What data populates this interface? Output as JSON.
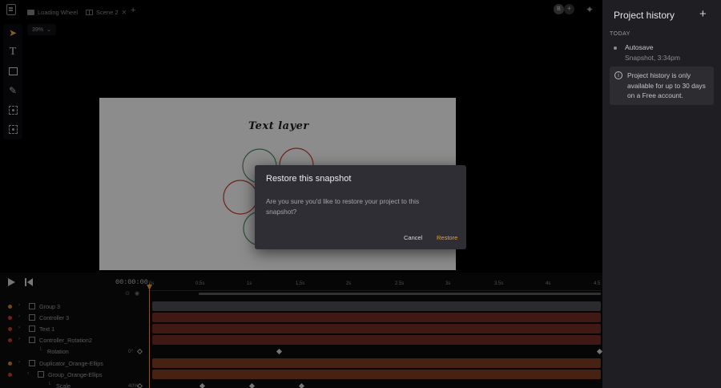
{
  "tabs": [
    {
      "label": "Loading Wheel",
      "icon": "folder-icon"
    },
    {
      "label": "Scene 2",
      "icon": "scene-icon"
    }
  ],
  "avatar_initial": "B",
  "zoom": "39%",
  "canvas": {
    "text_layer": "Text layer"
  },
  "dialog": {
    "title": "Restore this snapshot",
    "body": "Are you sure you'd like to restore your project to this snapshot?",
    "cancel": "Cancel",
    "restore": "Restore"
  },
  "timeline": {
    "timecode": "00:00:00",
    "ruler": [
      "0s",
      "0.5s",
      "1s",
      "1.5s",
      "2s",
      "2.5s",
      "3s",
      "3.5s",
      "4s",
      "4.5"
    ],
    "layers": [
      {
        "name": "Group 3",
        "dot": "#c7802f",
        "track": "#4a4a4e"
      },
      {
        "name": "Controller 3",
        "dot": "#c0392b",
        "track": "#6e2a24"
      },
      {
        "name": "Text 1",
        "dot": "#c0392b",
        "track": "#6e2a24"
      },
      {
        "name": "Controller_Rotation2",
        "dot": "#c0392b",
        "track": "#6e2a24"
      },
      {
        "name": "Rotation",
        "value": "0°"
      },
      {
        "name": "Duplicator_Orange-Ellips",
        "dot": "#c7802f",
        "track": "#7a3a1e"
      },
      {
        "name": "Group_Orange-Ellips",
        "dot": "#c0392b",
        "track": "#7a3a1e"
      },
      {
        "name": "Scale",
        "value": "40%, 40%"
      }
    ]
  },
  "panel": {
    "title": "Project history",
    "section": "TODAY",
    "history": [
      {
        "title": "Autosave",
        "subtitle": "Snapshot, 3:34pm"
      }
    ],
    "info": "Project history is only available for up to 30 days on a Free account."
  },
  "colors": {
    "accent": "#e6a040",
    "layer_red": "#c0392b",
    "layer_orange": "#c7802f"
  }
}
